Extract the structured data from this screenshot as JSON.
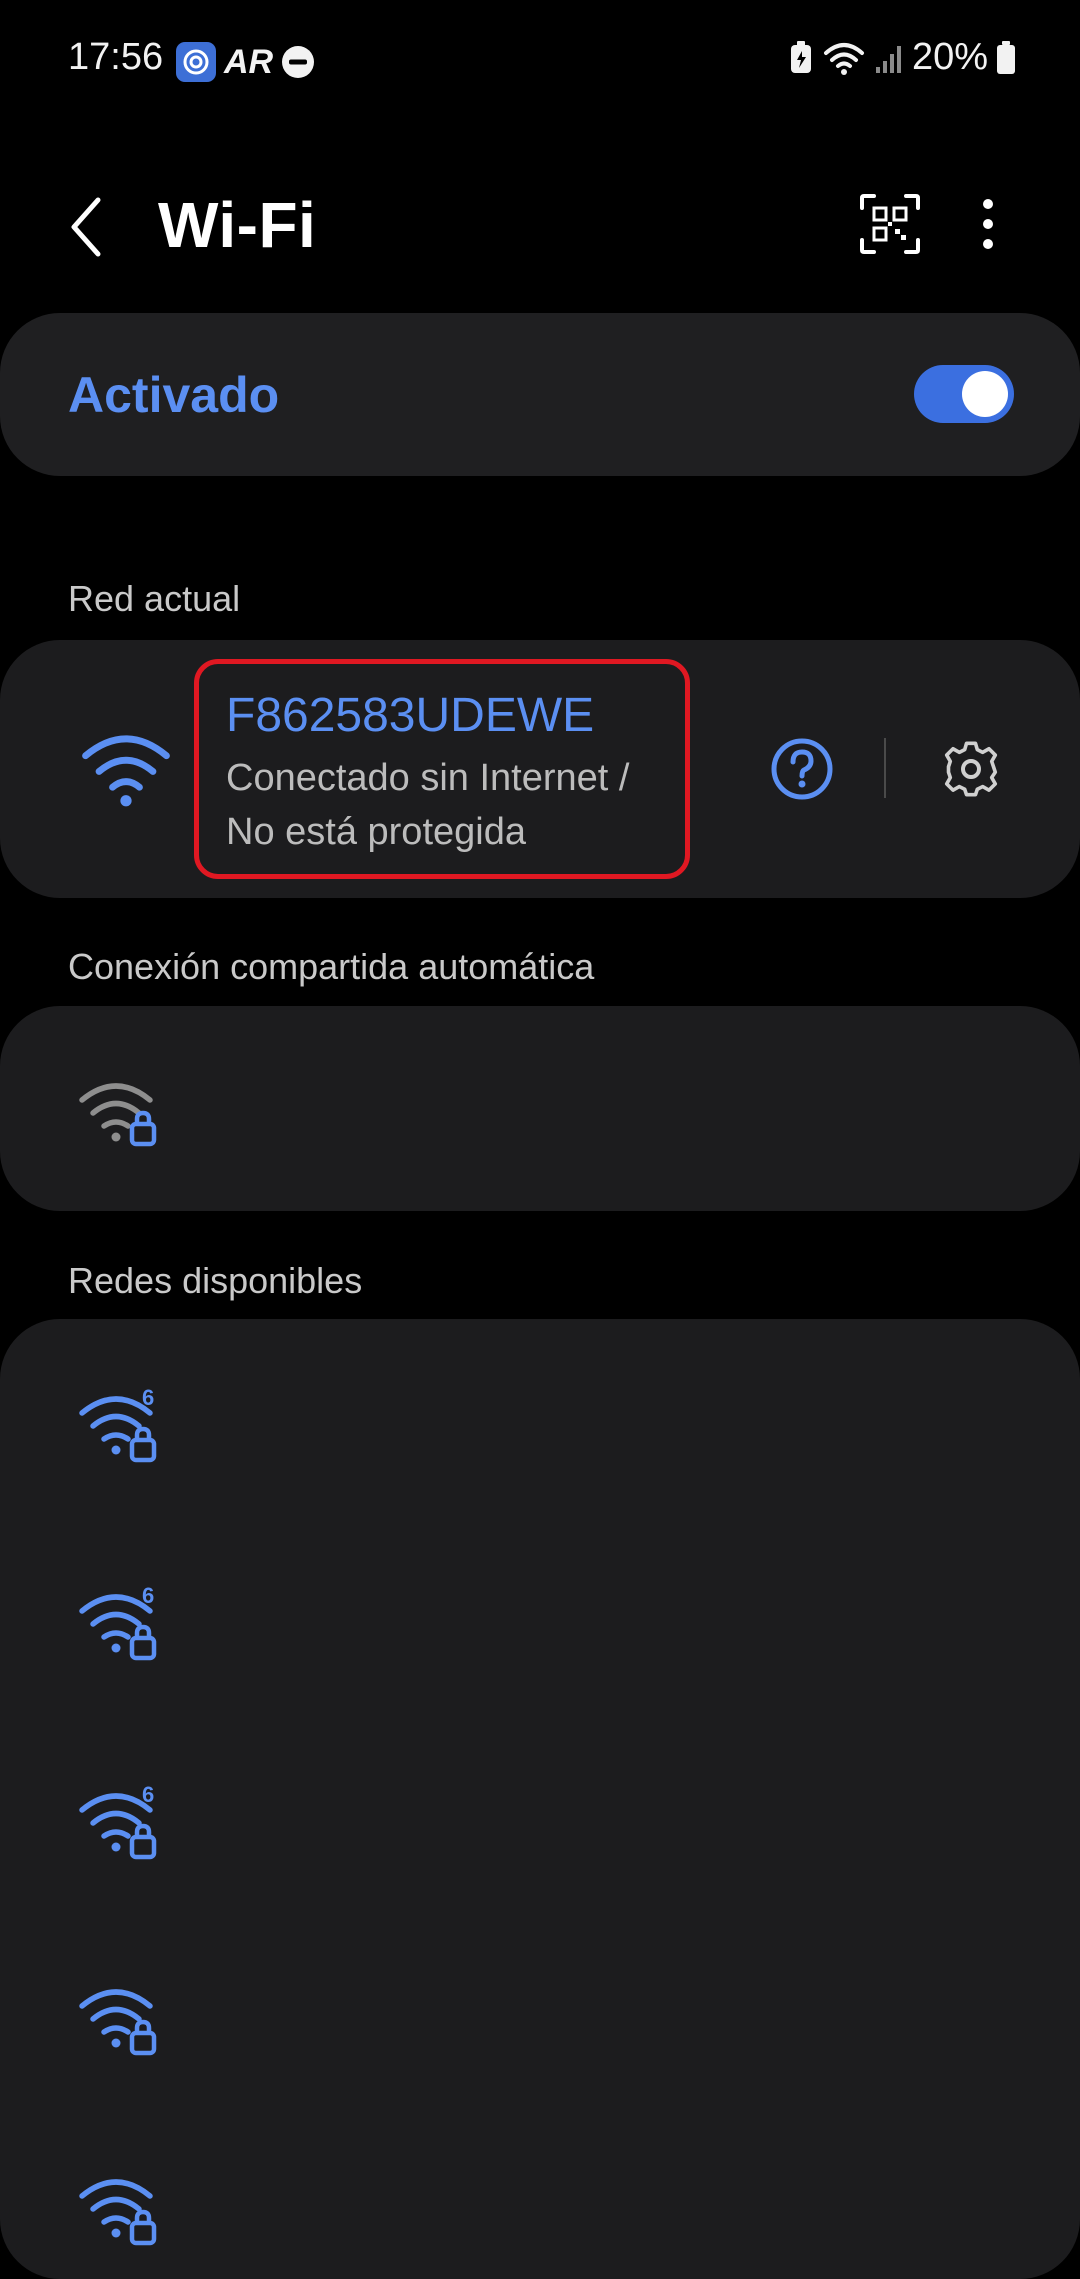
{
  "status_bar": {
    "time": "17:56",
    "app_badge_text": "AR",
    "battery": "20%",
    "icons": [
      "app-icon",
      "ar-icon",
      "do-not-disturb-icon",
      "battery-saver-icon",
      "wifi-status-icon",
      "cell-signal-icon",
      "battery-icon"
    ]
  },
  "header": {
    "title": "Wi-Fi",
    "back_icon": "chevron-left-icon",
    "qr_icon": "qr-scan-icon",
    "more_icon": "more-vertical-icon"
  },
  "wifi_toggle": {
    "label": "Activado",
    "on": true
  },
  "current_network": {
    "section_label": "Red actual",
    "name": "F862583UDEWE",
    "status_line1": "Conectado sin Internet /",
    "status_line2": "No está protegida",
    "help_icon": "help-circle-icon",
    "settings_icon": "gear-icon"
  },
  "auto_hotspot": {
    "section_label": "Conexión compartida automática"
  },
  "available": {
    "section_label": "Redes disponibles",
    "wifi6_badge": "6"
  },
  "colors": {
    "accent": "#5b8ff2",
    "card": "#1c1c1e",
    "highlight": "#e01822"
  }
}
